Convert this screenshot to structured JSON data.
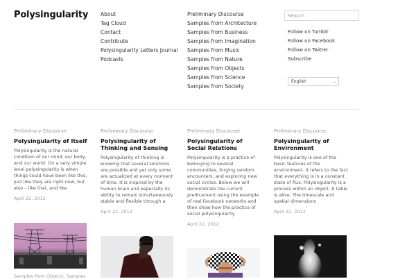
{
  "site": {
    "title": "Polysingularity"
  },
  "nav_primary": [
    {
      "label": "About"
    },
    {
      "label": "Tag Cloud"
    },
    {
      "label": "Contact"
    },
    {
      "label": "Contribute"
    },
    {
      "label": "Polysingularity Letters Journal"
    },
    {
      "label": "Podcasts"
    }
  ],
  "nav_secondary": [
    {
      "label": "Preliminary Discourse"
    },
    {
      "label": "Samples from Architecture"
    },
    {
      "label": "Samples from Business"
    },
    {
      "label": "Samples from Imagination"
    },
    {
      "label": "Samples from Music"
    },
    {
      "label": "Samples from Nature"
    },
    {
      "label": "Samples from Objects"
    },
    {
      "label": "Samples from Science"
    },
    {
      "label": "Samples from Society"
    }
  ],
  "search": {
    "placeholder": "Search"
  },
  "social": [
    {
      "label": "Follow on Tumblr"
    },
    {
      "label": "Follow on Facebook"
    },
    {
      "label": "Follow on Twitter"
    },
    {
      "label": "Subscribe"
    }
  ],
  "language": {
    "selected": "English"
  },
  "posts": [
    {
      "category": "Preliminary Discourse",
      "title": "Polysingularity of Itself",
      "excerpt": "Polysingularity is the natural condition of our mind, our body, and our world. On a very simple level polysingularity is when things could have been like this, just like they are right now, but also – like that, and like",
      "date": "April 22, 2012"
    },
    {
      "category": "Preliminary Discourse",
      "title": "Polysingularity of Thinking and Sensing",
      "excerpt": "Polysingularity of thinking is knowing that several solutions are possible and yet only some are actualized at every moment of time. It is inspired by the human brain and especially its ability to remain simultaneously stable and flexible through a",
      "date": "April 22, 2012"
    },
    {
      "category": "Preliminary Discourse",
      "title": "Polysingularity of Social Relations",
      "excerpt": "Polysingularity is a practice of belonging to several communities, forging random encounters, and exploring new social circles. Below we will demonstrate the current predicament using the example of real Facebook networks and then show how the practice of social polysingularity",
      "date": "April 22, 2012"
    },
    {
      "category": "Preliminary Discourse",
      "title": "Polysingularity of Environment",
      "excerpt": "Polysingularity is one of the basic features of the environment. It refers to the fact that everything is in a constant state of flux. Polysingularity is a process within an object. A table is alive. The timescale and spatial dimensions",
      "date": "April 22, 2012"
    }
  ],
  "thumbnails": {
    "caption_1": "Samples from Objects, Samples"
  }
}
